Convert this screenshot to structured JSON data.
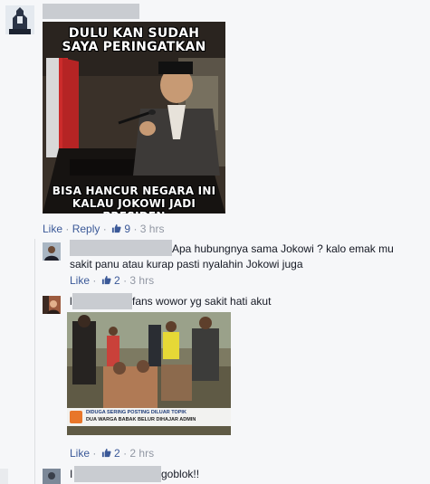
{
  "post": {
    "meme_caption_top_line1": "DULU KAN SUDAH",
    "meme_caption_top_line2": "SAYA PERINGATKAN",
    "meme_caption_bottom_line1": "BISA HANCUR NEGARA INI",
    "meme_caption_bottom_line2": "KALAU JOKOWI JADI PRESIDEN",
    "actions": {
      "like": "Like",
      "reply": "Reply",
      "dot": "·",
      "likes": "9",
      "time": "3 hrs"
    }
  },
  "replies": [
    {
      "text_line1": "Apa hubungnya sama Jokowi ? kalo emak mu",
      "text_line2": "sakit panu atau kurap pasti nyalahin Jokowi juga",
      "actions": {
        "like": "Like",
        "dot": "·",
        "likes": "2",
        "time": "3 hrs"
      }
    },
    {
      "text_prefix": "l",
      "text": "fans wowor yg sakit hati akut",
      "news_line1": "DIDUGA SERING POSTING DILUAR TOPIK",
      "news_line2": "DUA WARGA BABAK BELUR DIHAJAR ADMIN",
      "actions": {
        "like": "Like",
        "dot": "·",
        "likes": "2",
        "time": "2 hrs"
      }
    },
    {
      "text_prefix": "I",
      "text": "goblok!!"
    }
  ],
  "colors": {
    "link": "#3b5998",
    "meta": "#9197a3",
    "redaction": "#c9ccd1",
    "background": "#f6f7f9"
  },
  "icons": {
    "like": "thumbs-up-icon"
  }
}
